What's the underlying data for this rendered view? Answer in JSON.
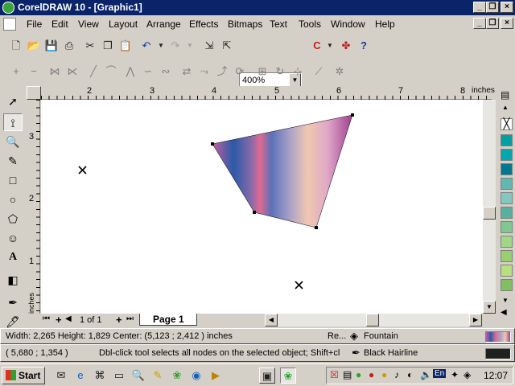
{
  "app": {
    "title": "CorelDRAW 10 - [Graphic1]"
  },
  "menu": {
    "items": [
      "File",
      "Edit",
      "View",
      "Layout",
      "Arrange",
      "Effects",
      "Bitmaps",
      "Text",
      "Tools",
      "Window",
      "Help"
    ]
  },
  "toolbar": {
    "zoom": "400%",
    "spin_value": "0"
  },
  "ruler": {
    "h_ticks": [
      "2",
      "3",
      "4",
      "5",
      "6",
      "7",
      "8"
    ],
    "v_ticks": [
      "3",
      "2",
      "1"
    ],
    "unit_h": "inches",
    "unit_v": "inches"
  },
  "page_nav": {
    "page_count_text": "1 of 1",
    "tab_label": "Page 1"
  },
  "status": {
    "dimensions": "Width: 2,265  Height: 1,829  Center: (5,123 ; 2,412 )  inches",
    "object_type": "Re...",
    "fill_label": "Fountain",
    "cursor_pos": "( 5,680 ; 1,354  )",
    "hint": "Dbl-click tool selects all nodes on the selected object; Shift+clic...",
    "outline_label": "Black  Hairline"
  },
  "palette": {
    "colors": [
      "#ffffff",
      "#00a0a0",
      "#00a8b0",
      "#007890",
      "#60b8b0",
      "#80c8c0",
      "#58b0a0",
      "#80c890",
      "#a0d888",
      "#98d070",
      "#b8e080",
      "#80c060"
    ]
  },
  "taskbar": {
    "start_label": "Start",
    "clock": "12:07"
  }
}
